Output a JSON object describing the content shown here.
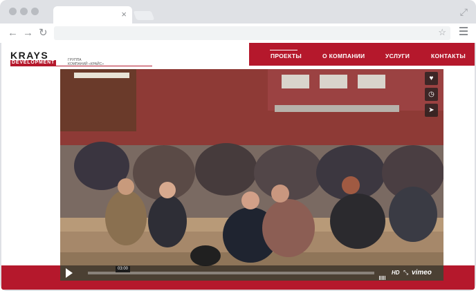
{
  "browser": {
    "tab_close": "×",
    "nav_back": "←",
    "nav_forward": "→",
    "nav_reload": "↻",
    "url": "",
    "star": "☆",
    "expand": "⤢"
  },
  "logo": {
    "name": "KRAYS",
    "sub": "DEVELOPMENT",
    "group_line1": "ГРУППА",
    "group_line2": "КОМПАНИЙ «КРАЙС»"
  },
  "nav": {
    "items": [
      "ПРОЕКТЫ",
      "О КОМПАНИИ",
      "УСЛУГИ",
      "КОНТАКТЫ"
    ],
    "active": "ПРОЕКТЫ"
  },
  "video": {
    "timecode": "03:00",
    "quality": "HD",
    "provider": "vimeo",
    "actions": [
      "heart-icon",
      "clock-icon",
      "send-icon"
    ]
  },
  "colors": {
    "accent": "#b5182c",
    "chrome": "#dfe1e5"
  }
}
